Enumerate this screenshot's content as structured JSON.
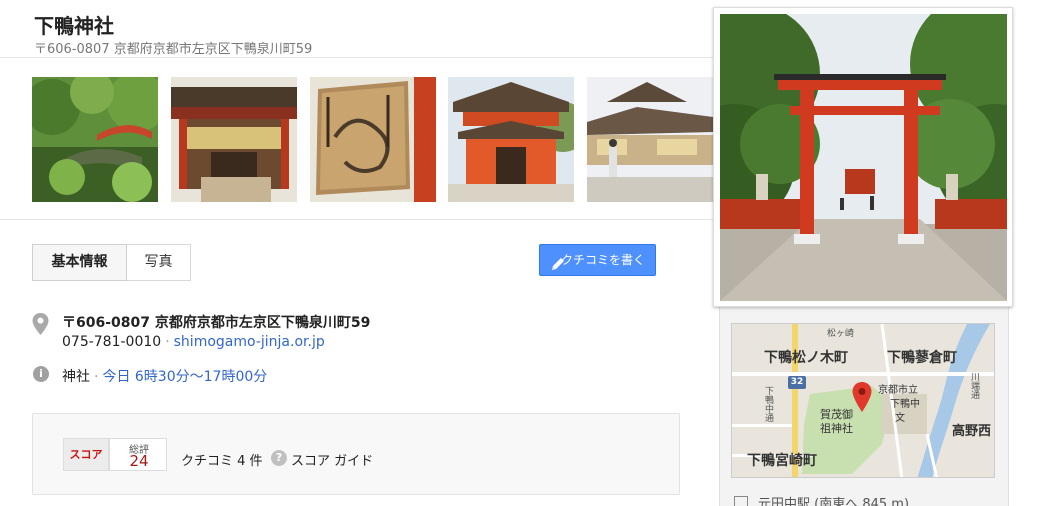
{
  "place": {
    "name": "下鴨神社",
    "header_address": "〒606-0807 京都府京都市左京区下鴨泉川町59"
  },
  "tabs": [
    {
      "label": "基本情報",
      "active": true
    },
    {
      "label": "写真",
      "active": false
    }
  ],
  "review_button": {
    "label": "クチコミを書く",
    "icon": "pencil-icon"
  },
  "info": {
    "address": "〒606-0807 京都府京都市左京区下鴨泉川町59",
    "phone": "075-781-0010",
    "website": "shimogamo-jinja.or.jp",
    "category": "神社",
    "hours": "今日 6時30分～17時00分"
  },
  "score": {
    "logo_text": "スコア",
    "overall_label": "総評",
    "overall_value": "24",
    "review_count": "クチコミ 4 件",
    "guide_label": "スコア ガイド"
  },
  "map": {
    "labels": [
      "下鴨松ノ木町",
      "下鴨蓼倉町",
      "京都市立",
      "下鴨中",
      "文",
      "賀茂御",
      "祖神社",
      "高野西",
      "下鴨宮崎町",
      "松ヶ崎",
      "川端通",
      "下鴨中通"
    ],
    "route_number": "32"
  },
  "nearby_station": "元田中駅 (南東へ 845 m)",
  "colors": {
    "accent_blue": "#4d90fe",
    "link_blue": "#3366cc",
    "score_red": "#a31a1a",
    "torii_red": "#d03a1e"
  }
}
